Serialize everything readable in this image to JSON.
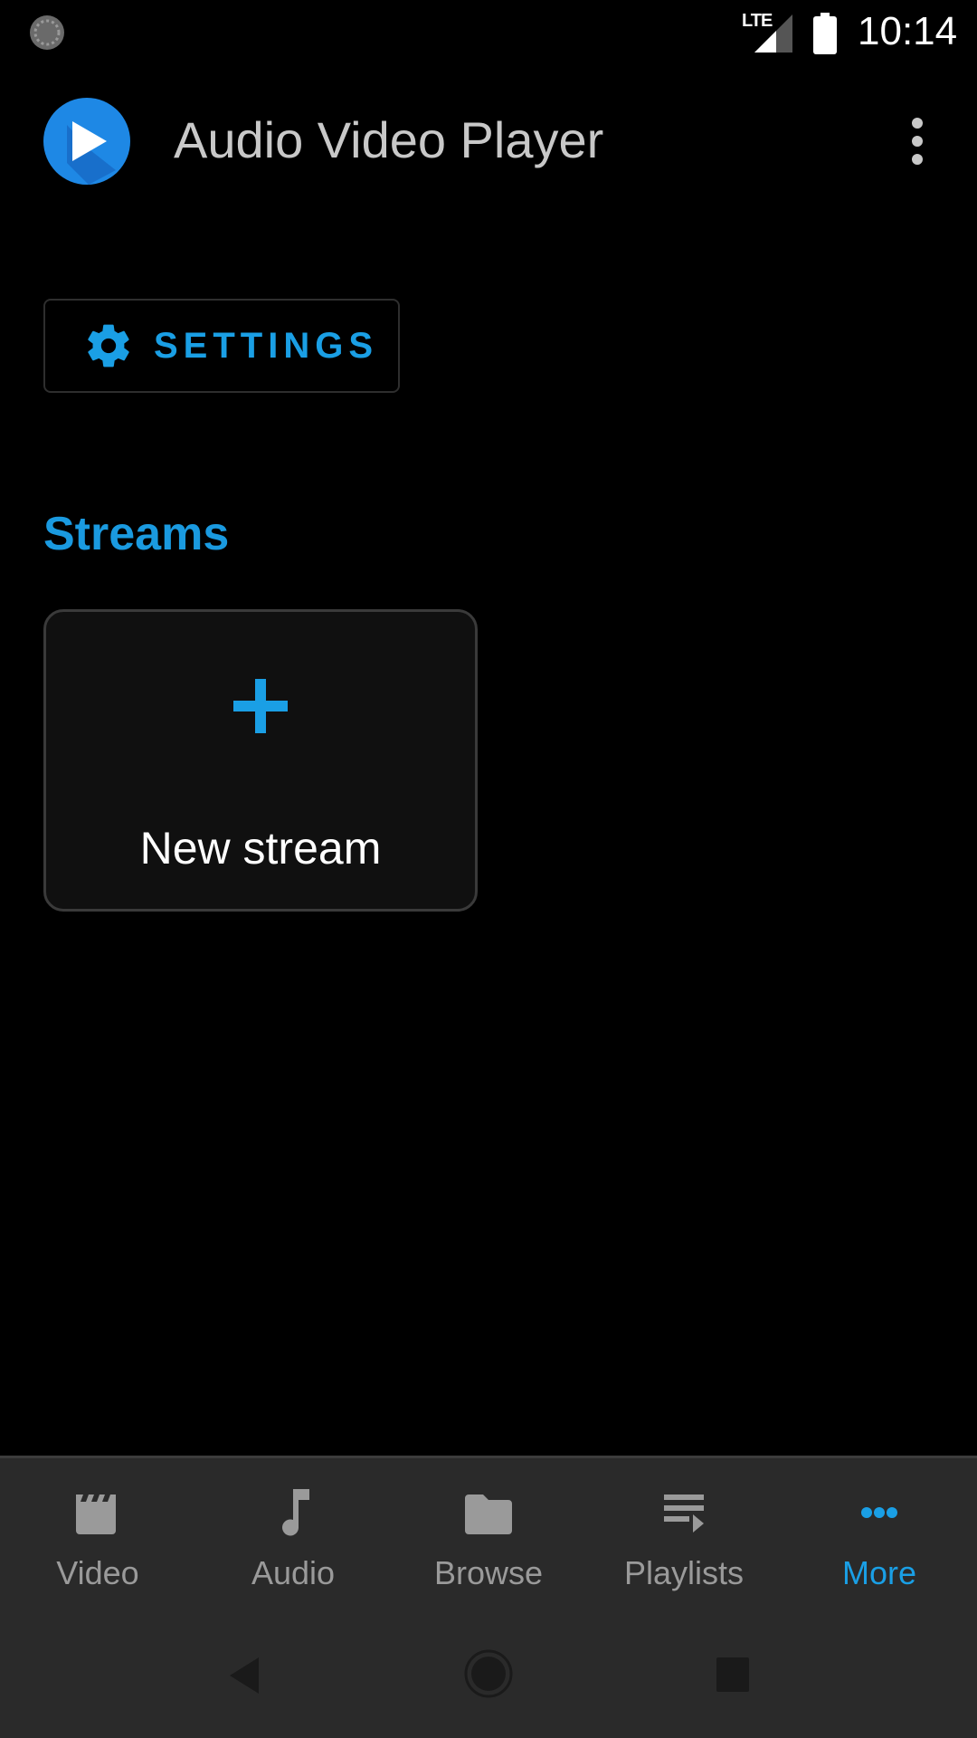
{
  "status_bar": {
    "network_label": "LTE",
    "time": "10:14",
    "icons": [
      "sync-icon",
      "signal-icon",
      "battery-icon"
    ]
  },
  "app_bar": {
    "title": "Audio Video Player",
    "logo_icon": "play-logo-icon",
    "overflow_icon": "more-vert-icon"
  },
  "settings_button": {
    "label": "SETTINGS",
    "icon": "gear-icon"
  },
  "streams": {
    "title": "Streams",
    "new_stream": {
      "label": "New stream",
      "icon": "plus-icon"
    }
  },
  "bottom_nav": {
    "items": [
      {
        "label": "Video",
        "icon": "clapperboard-icon",
        "active": false
      },
      {
        "label": "Audio",
        "icon": "music-note-icon",
        "active": false
      },
      {
        "label": "Browse",
        "icon": "folder-icon",
        "active": false
      },
      {
        "label": "Playlists",
        "icon": "playlist-icon",
        "active": false
      },
      {
        "label": "More",
        "icon": "more-horiz-icon",
        "active": true
      }
    ]
  },
  "system_nav": {
    "buttons": [
      "back-icon",
      "home-icon",
      "recents-icon"
    ]
  },
  "colors": {
    "accent": "#1a9fe5",
    "background": "#000000",
    "nav_background": "#2a2a2a",
    "inactive": "#9a9a9a"
  }
}
